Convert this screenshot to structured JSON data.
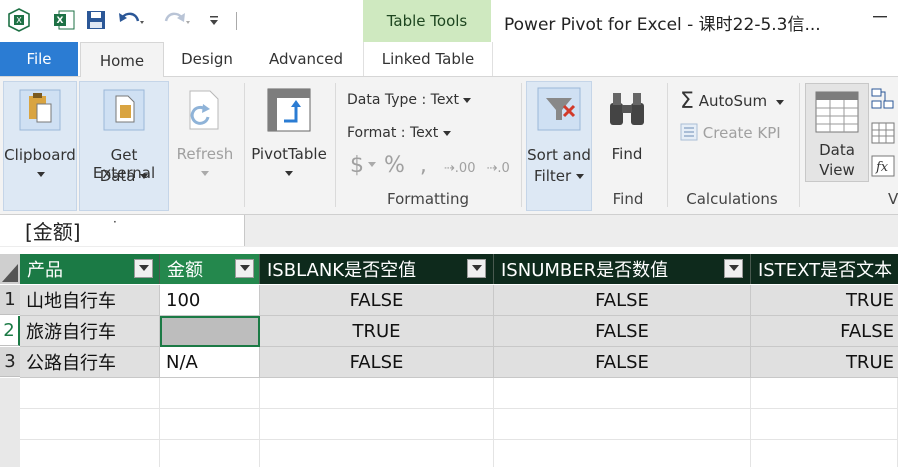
{
  "window": {
    "title": "Power Pivot for Excel - 课时22-5.3信...",
    "context_tab_group": "Table Tools"
  },
  "tabs": [
    "File",
    "Home",
    "Design",
    "Advanced",
    "Linked Table"
  ],
  "ribbon": {
    "clipboard": {
      "label": "Clipboard"
    },
    "get_external": {
      "line1": "Get External",
      "line2": "Data"
    },
    "refresh": {
      "label": "Refresh"
    },
    "pivottable": {
      "label": "PivotTable"
    },
    "formatting": {
      "data_type": "Data Type : Text",
      "format": "Format : Text",
      "group_label": "Formatting"
    },
    "sort_filter": {
      "line1": "Sort and",
      "line2": "Filter"
    },
    "find": {
      "label": "Find",
      "group_label": "Find"
    },
    "calculations": {
      "autosum": "AutoSum",
      "create_kpi": "Create KPI",
      "group_label": "Calculations"
    },
    "data_view": {
      "line1": "Data",
      "line2": "View"
    },
    "view_group_partial": "V"
  },
  "namebox": {
    "value": "[金额]"
  },
  "table": {
    "columns": [
      "产品",
      "金额",
      "ISBLANK是否空值",
      "ISNUMBER是否数值",
      "ISTEXT是否文本"
    ],
    "rows": [
      {
        "num": "1",
        "cells": [
          "山地自行车",
          "100",
          "FALSE",
          "FALSE",
          "TRUE"
        ]
      },
      {
        "num": "2",
        "cells": [
          "旅游自行车",
          "",
          "TRUE",
          "FALSE",
          "FALSE"
        ]
      },
      {
        "num": "3",
        "cells": [
          "公路自行车",
          "N/A",
          "FALSE",
          "FALSE",
          "TRUE"
        ]
      }
    ]
  },
  "colors": {
    "accent_file_tab": "#2b7cd3",
    "table_tools": "#cfe9c0",
    "header_dark": "#0e2a1c",
    "header_green": "#1b7a45"
  }
}
